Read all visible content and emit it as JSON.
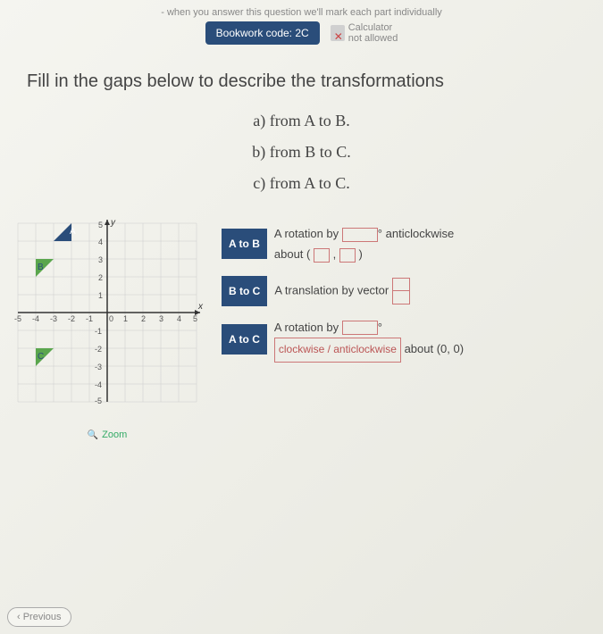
{
  "header": {
    "note": "- when you answer this question we'll mark each part individually",
    "bookwork": "Bookwork code: 2C",
    "calc_label": "Calculator",
    "calc_status": "not allowed"
  },
  "question": {
    "main": "Fill in the gaps below to describe the transformations",
    "a": "a) from A to B.",
    "b": "b) from B to C.",
    "c": "c) from A to C."
  },
  "graph": {
    "labels": {
      "A": "A",
      "B": "B",
      "C": "C",
      "x": "x",
      "y": "y"
    },
    "axis_x": [
      "-5",
      "-4",
      "-3",
      "-2",
      "-1",
      "0",
      "1",
      "2",
      "3",
      "4",
      "5"
    ],
    "axis_y_pos": [
      "1",
      "2",
      "3",
      "4",
      "5"
    ],
    "axis_y_neg": [
      "-1",
      "-2",
      "-3",
      "-4",
      "-5"
    ]
  },
  "answers": {
    "atob": {
      "tag": "A to B",
      "t1": "A rotation by",
      "unit": "°",
      "t2": "anticlockwise",
      "t3": "about (",
      "t4": ",",
      "t5": ")"
    },
    "btoc": {
      "tag": "B to C",
      "t1": "A translation by vector"
    },
    "atoc": {
      "tag": "A to C",
      "t1": "A rotation by",
      "unit": "°",
      "choice": "clockwise / anticlockwise",
      "t2": "about (0, 0)"
    }
  },
  "zoom": "Zoom",
  "prev": "‹ Previous",
  "chart_data": {
    "type": "scatter",
    "title": "",
    "xlabel": "x",
    "ylabel": "y",
    "xlim": [
      -5,
      5
    ],
    "ylim": [
      -5,
      5
    ],
    "grid": true,
    "shapes": [
      {
        "name": "A",
        "type": "triangle",
        "vertices": [
          [
            -2,
            5
          ],
          [
            -2,
            4
          ],
          [
            -3,
            4
          ]
        ],
        "fill": "#2a4d7a"
      },
      {
        "name": "B",
        "type": "triangle",
        "vertices": [
          [
            -4,
            3
          ],
          [
            -4,
            2
          ],
          [
            -3,
            3
          ]
        ],
        "fill": "#5aa64d"
      },
      {
        "name": "C",
        "type": "triangle",
        "vertices": [
          [
            -4,
            -2
          ],
          [
            -4,
            -3
          ],
          [
            -3,
            -2
          ]
        ],
        "fill": "#5aa64d"
      }
    ]
  }
}
